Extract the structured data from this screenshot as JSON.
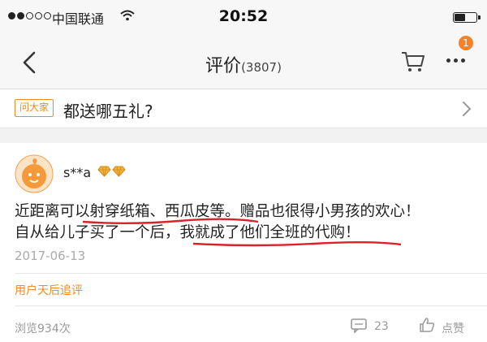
{
  "status_bar": {
    "carrier": "中国联通",
    "time": "20:52",
    "battery_level": 0.45,
    "signal_dots_filled": 2,
    "signal_dots_total": 5
  },
  "nav": {
    "title": "评价",
    "count": "(3807)",
    "notification_badge": "1",
    "icons": [
      "back-icon",
      "cart-icon",
      "more-icon"
    ]
  },
  "ask": {
    "tag": "问大家",
    "question": "都送哪五礼?"
  },
  "review": {
    "username": "s**a",
    "text_line1": "近距离可以射穿纸箱、西瓜皮等。赠品也很得小男孩的欢心！",
    "text_line2": "自从给儿子买了一个后，我就成了他们全班的代购！",
    "date": "2017-06-13",
    "followup_label": "用户天后追评",
    "views": "浏览934次",
    "comment_count": "23",
    "like_label": "点赞"
  },
  "colors": {
    "accent": "#f08a24",
    "underline": "#d8232a",
    "muted": "#999999"
  }
}
